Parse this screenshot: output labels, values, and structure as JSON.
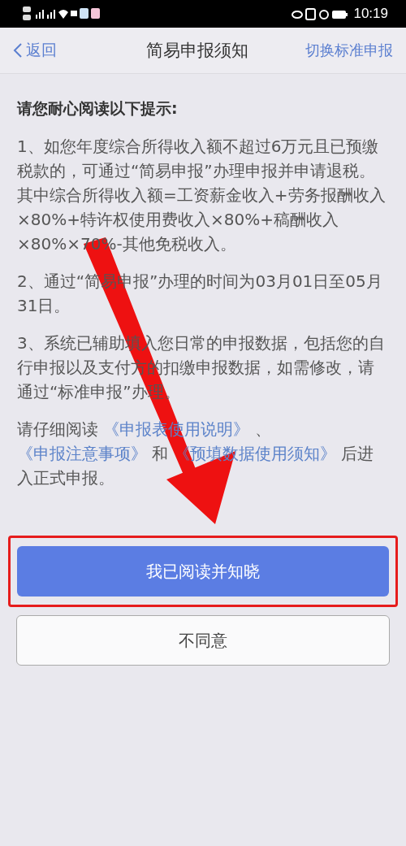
{
  "status_bar": {
    "time": "10:19"
  },
  "nav": {
    "back": "返回",
    "title": "简易申报须知",
    "action": "切换标准申报"
  },
  "heading": "请您耐心阅读以下提示:",
  "paragraphs": [
    "1、如您年度综合所得收入额不超过6万元且已预缴税款的，可通过“简易申报”办理申报并申请退税。其中综合所得收入额=工资薪金收入+劳务报酬收入×80%+特许权使用费收入×80%+稿酬收入×80%×70%-其他免税收入。",
    "2、通过“简易申报”办理的时间为03月01日至05月31日。",
    "3、系统已辅助填入您日常的申报数据，包括您的自行申报以及支付方的扣缴申报数据，如需修改，请通过“标准申报”办理。"
  ],
  "notice": [
    {
      "kind": "text",
      "text": "请仔细阅读"
    },
    {
      "kind": "link",
      "text": "《申报表使用说明》"
    },
    {
      "kind": "text",
      "text": "、"
    },
    {
      "kind": "link",
      "text": "《申报注意事项》"
    },
    {
      "kind": "text",
      "text": "和"
    },
    {
      "kind": "link",
      "text": "《预填数据使用须知》"
    },
    {
      "kind": "text",
      "text": "后进入正式申报。"
    }
  ],
  "buttons": [
    {
      "label": "我已阅读并知晓",
      "kind": "primary",
      "highlighted": true
    },
    {
      "label": "不同意",
      "kind": "secondary",
      "highlighted": false
    }
  ]
}
